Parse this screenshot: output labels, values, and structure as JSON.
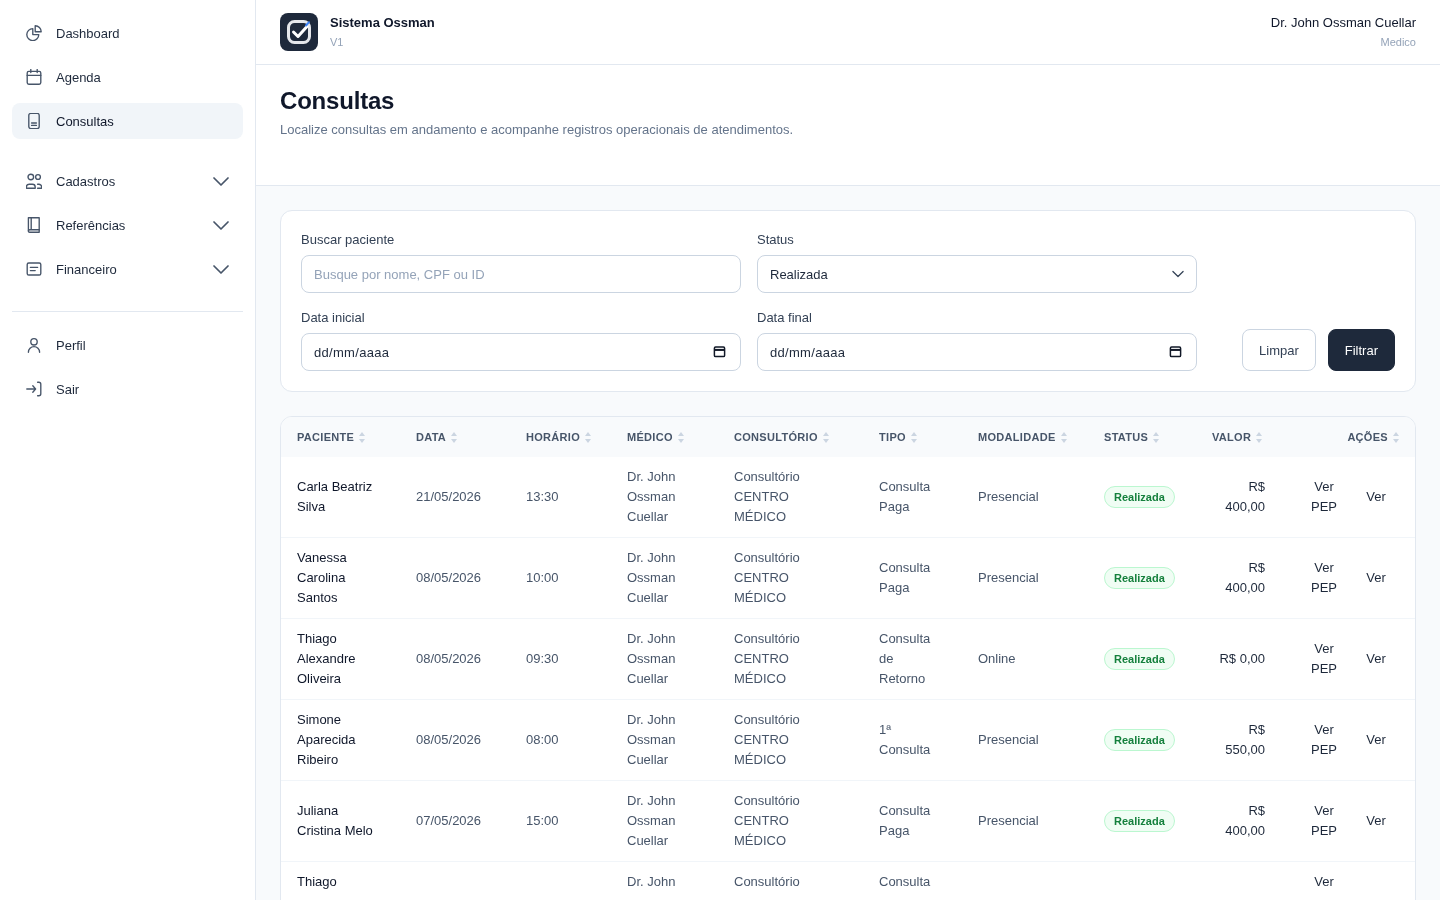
{
  "sidebar": {
    "nav": [
      {
        "label": "Dashboard",
        "selected": false
      },
      {
        "label": "Agenda",
        "selected": false
      },
      {
        "label": "Consultas",
        "selected": true
      }
    ],
    "groups": [
      {
        "label": "Cadastros",
        "selected": false,
        "expanded": false
      },
      {
        "label": "Referências",
        "selected": false,
        "expanded": false
      },
      {
        "label": "Financeiro",
        "selected": false,
        "expanded": false
      }
    ],
    "account": [
      {
        "label": "Perfil",
        "selected": false
      },
      {
        "label": "Sair",
        "selected": false
      }
    ]
  },
  "topbar": {
    "app_name": "Sistema Ossman",
    "version": "V1",
    "user_name": "Dr. John Ossman Cuellar",
    "user_role": "Medico"
  },
  "page": {
    "title": "Consultas",
    "subtitle": "Localize consultas em andamento e acompanhe registros operacionais de atendimentos."
  },
  "filters": {
    "fields": [
      {
        "kind": "text",
        "label": "Buscar paciente",
        "placeholder": "Busque por nome, CPF ou ID"
      },
      {
        "kind": "select",
        "label": "Status",
        "value": "Realizada"
      },
      {
        "kind": "date",
        "label": "Data inicial",
        "placeholder": "dd/mm/aaaa"
      },
      {
        "kind": "date",
        "label": "Data final",
        "placeholder": "dd/mm/aaaa"
      }
    ],
    "buttons": [
      {
        "kind": "secondary",
        "label": "Limpar"
      },
      {
        "kind": "primary",
        "label": "Filtrar"
      }
    ]
  },
  "table": {
    "columns": [
      {
        "label": "PACIENTE",
        "sortable": true
      },
      {
        "label": "DATA",
        "sortable": true
      },
      {
        "label": "HORÁRIO",
        "sortable": true
      },
      {
        "label": "MÉDICO",
        "sortable": true
      },
      {
        "label": "CONSULTÓRIO",
        "sortable": true
      },
      {
        "label": "TIPO",
        "sortable": true
      },
      {
        "label": "MODALIDADE",
        "sortable": true
      },
      {
        "label": "STATUS",
        "sortable": true
      },
      {
        "label": "VALOR",
        "sortable": true
      },
      {
        "label": "AÇÕES",
        "sortable": true
      }
    ],
    "rows": [
      {
        "paciente": "Carla Beatriz Silva",
        "data": "21/05/2026",
        "horario": "13:30",
        "medico": "Dr. John Ossman Cuellar",
        "consultorio": "Consultório CENTRO MÉDICO",
        "tipo": "Consulta Paga",
        "modalidade": "Presencial",
        "status": "Realizada",
        "valor": "R$ 400,00",
        "acoes": [
          "Ver PEP",
          "Ver"
        ]
      },
      {
        "paciente": "Vanessa Carolina Santos",
        "data": "08/05/2026",
        "horario": "10:00",
        "medico": "Dr. John Ossman Cuellar",
        "consultorio": "Consultório CENTRO MÉDICO",
        "tipo": "Consulta Paga",
        "modalidade": "Presencial",
        "status": "Realizada",
        "valor": "R$ 400,00",
        "acoes": [
          "Ver PEP",
          "Ver"
        ]
      },
      {
        "paciente": "Thiago Alexandre Oliveira",
        "data": "08/05/2026",
        "horario": "09:30",
        "medico": "Dr. John Ossman Cuellar",
        "consultorio": "Consultório CENTRO MÉDICO",
        "tipo": "Consulta de Retorno",
        "modalidade": "Online",
        "status": "Realizada",
        "valor": "R$ 0,00",
        "acoes": [
          "Ver PEP",
          "Ver"
        ]
      },
      {
        "paciente": "Simone Aparecida Ribeiro",
        "data": "08/05/2026",
        "horario": "08:00",
        "medico": "Dr. John Ossman Cuellar",
        "consultorio": "Consultório CENTRO MÉDICO",
        "tipo": "1ª Consulta",
        "modalidade": "Presencial",
        "status": "Realizada",
        "valor": "R$ 550,00",
        "acoes": [
          "Ver PEP",
          "Ver"
        ]
      },
      {
        "paciente": "Juliana Cristina Melo",
        "data": "07/05/2026",
        "horario": "15:00",
        "medico": "Dr. John Ossman Cuellar",
        "consultorio": "Consultório CENTRO MÉDICO",
        "tipo": "Consulta Paga",
        "modalidade": "Presencial",
        "status": "Realizada",
        "valor": "R$ 400,00",
        "acoes": [
          "Ver PEP",
          "Ver"
        ]
      },
      {
        "paciente": "Thiago",
        "medico": "Dr. John",
        "consultorio": "Consultório",
        "tipo": "Consulta",
        "acoes": [
          "Ver"
        ]
      }
    ]
  }
}
